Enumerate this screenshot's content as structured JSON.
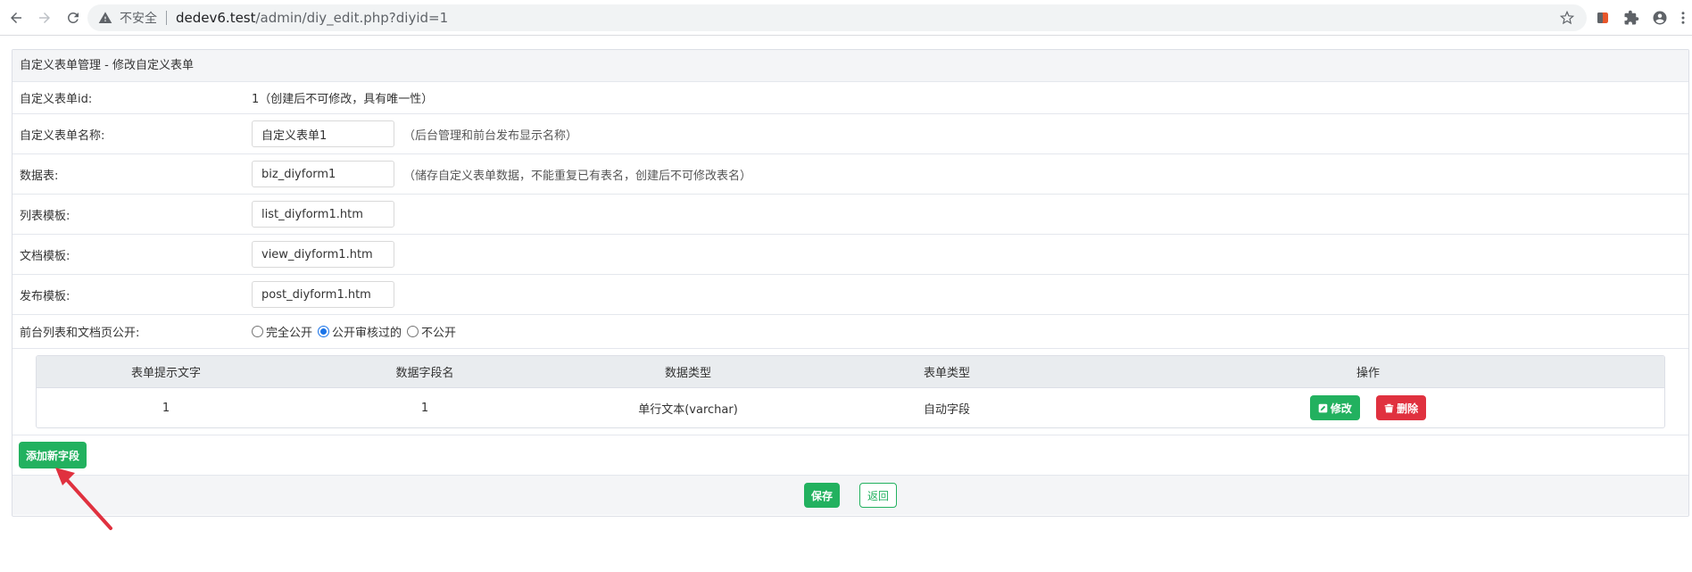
{
  "browser": {
    "insecure_label": "不安全",
    "url_host": "dedev6.test",
    "url_path": "/admin/diy_edit.php?diyid=1"
  },
  "panel": {
    "title": "自定义表单管理 - 修改自定义表单"
  },
  "form": {
    "id_label": "自定义表单id:",
    "id_value": "1（创建后不可修改，具有唯一性）",
    "name_label": "自定义表单名称:",
    "name_value": "自定义表单1",
    "name_hint": "（后台管理和前台发布显示名称）",
    "table_label": "数据表:",
    "table_value": "biz_diyform1",
    "table_hint": "（储存自定义表单数据，不能重复已有表名，创建后不可修改表名）",
    "list_tpl_label": "列表模板:",
    "list_tpl_value": "list_diyform1.htm",
    "view_tpl_label": "文档模板:",
    "view_tpl_value": "view_diyform1.htm",
    "post_tpl_label": "发布模板:",
    "post_tpl_value": "post_diyform1.htm",
    "public_label": "前台列表和文档页公开:",
    "public_options": [
      "完全公开",
      "公开审核过的",
      "不公开"
    ],
    "public_selected": "公开审核过的"
  },
  "fields_table": {
    "headers": [
      "表单提示文字",
      "数据字段名",
      "数据类型",
      "表单类型",
      "操作"
    ],
    "rows": [
      {
        "hint": "1",
        "field": "1",
        "dtype": "单行文本(varchar)",
        "ftype": "自动字段"
      }
    ],
    "edit_label": "修改",
    "delete_label": "删除"
  },
  "buttons": {
    "add_field": "添加新字段",
    "save": "保存",
    "back": "返回"
  },
  "colors": {
    "green": "#22b15f",
    "red": "#e0313f",
    "arrow": "#e0313f"
  }
}
